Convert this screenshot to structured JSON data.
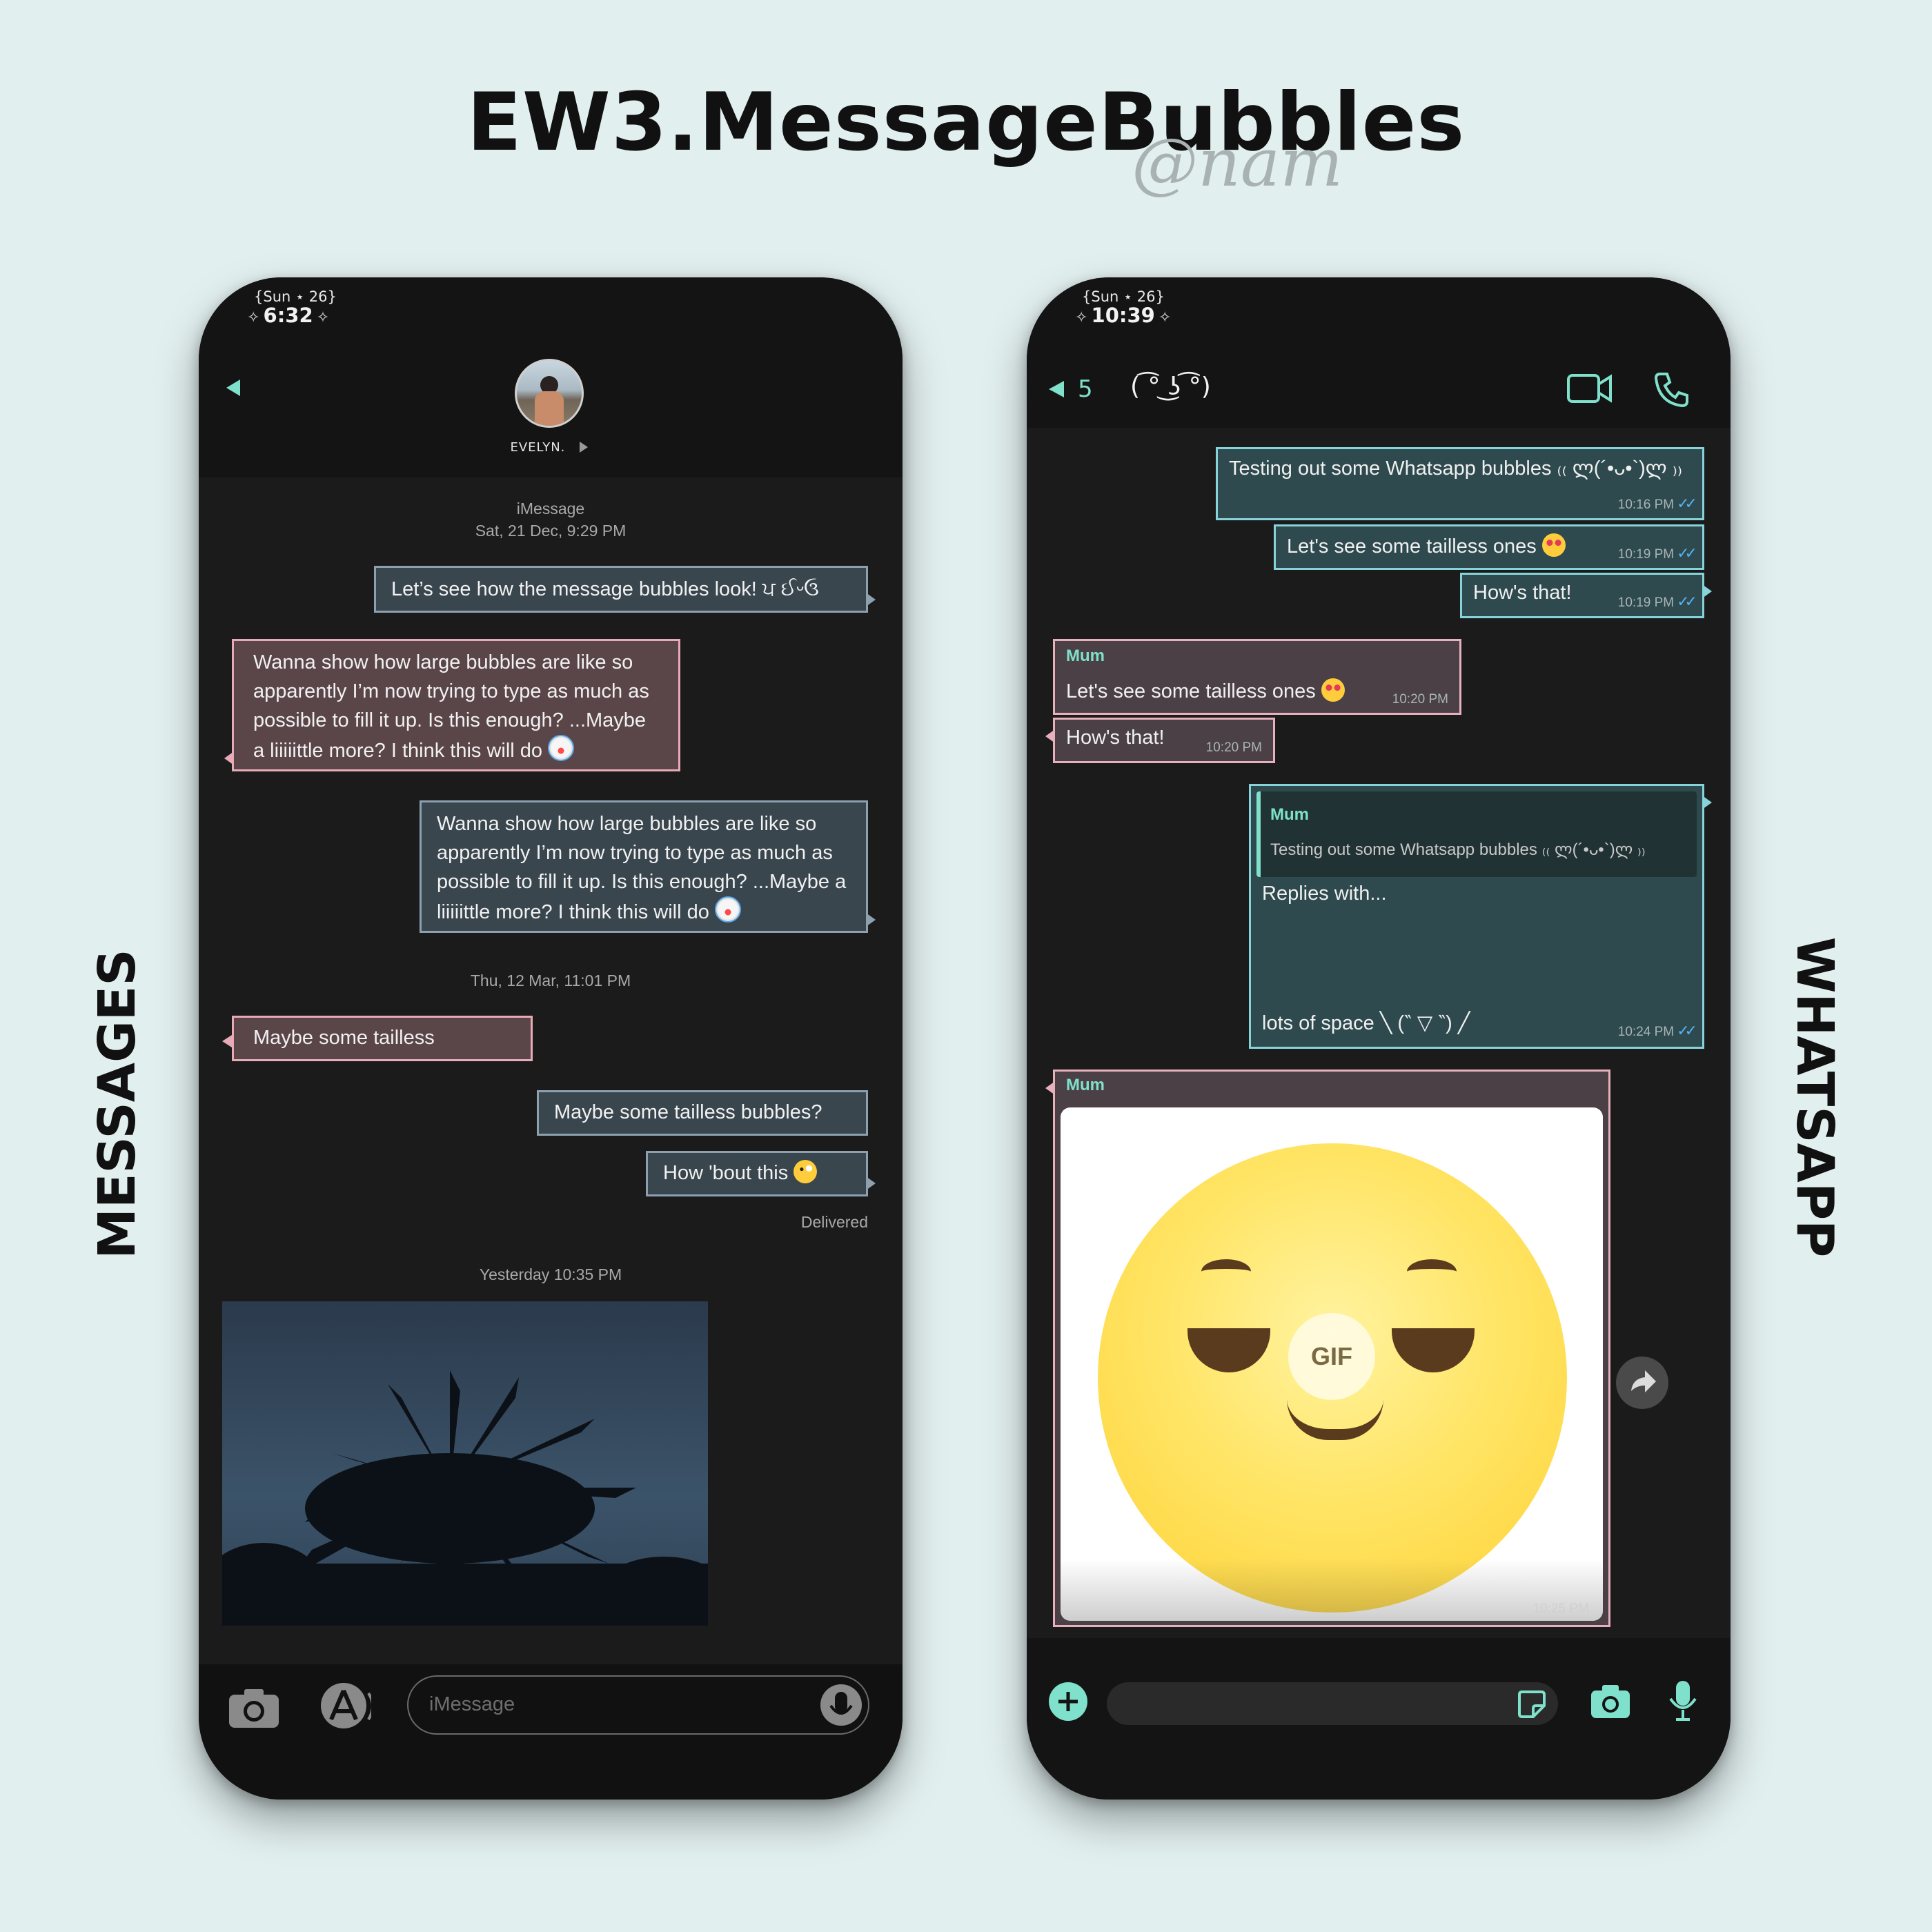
{
  "header": {
    "title": "EW3.MessageBubbles",
    "handle": "@nam"
  },
  "labels": {
    "left": "MESSAGES",
    "right": "WHATSAPP"
  },
  "messages_app": {
    "status": {
      "date": "{Sun ⋆ 26}",
      "time": "6:32"
    },
    "contact": {
      "name": "EVELYN."
    },
    "service_label": "iMessage",
    "timestamp1": "Sat, 21 Dec, 9:29 PM",
    "bubble1": "Let’s see how the message bubbles look! ਪ ઈᵕઉ",
    "bubble2": "Wanna show how large bubbles are like so apparently I’m now trying to type as much as possible to fill it up. Is this enough? ...Maybe a liiiiittle more? I think this will do",
    "bubble3": "Wanna show how large bubbles are like so apparently I’m now trying to type as much as possible to fill it up. Is this enough? ...Maybe a liiiiittle more? I think this will do",
    "timestamp2": "Thu, 12 Mar, 11:01 PM",
    "bubble4": "Maybe some tailless",
    "bubble5": "Maybe some tailless bubbles?",
    "bubble6": "How 'bout this",
    "delivered": "Delivered",
    "timestamp3": "Yesterday 10:35 PM",
    "input_placeholder": "iMessage",
    "icons": {
      "back": "back-arrow-icon",
      "camera": "camera-icon",
      "appstore": "app-store-icon",
      "audio": "audio-icon"
    },
    "colors": {
      "accent": "#7fe0cb",
      "outgoing_border": "#8da0b0",
      "incoming_border": "#e8aab7"
    }
  },
  "whatsapp_app": {
    "status": {
      "date": "{Sun ⋆ 26}",
      "time": "10:39"
    },
    "header": {
      "unread_count": "5",
      "contact": "( ͡° ͜ʖ ͡°)"
    },
    "messages": {
      "m1": {
        "text": "Testing out some Whatsapp bubbles ₍₍ ლ(´•ᴗ•`)ლ ₎₎",
        "time": "10:16 PM"
      },
      "m2": {
        "text": "Let's see some tailless ones",
        "time": "10:19 PM"
      },
      "m3": {
        "text": "How's that!",
        "time": "10:19 PM"
      },
      "m4": {
        "sender": "Mum",
        "text": "Let's see some tailless ones",
        "time": "10:20 PM"
      },
      "m5": {
        "text": "How's that!",
        "time": "10:20 PM"
      },
      "m6": {
        "quote_sender": "Mum",
        "quote_text": "Testing out some Whatsapp bubbles ₍₍ ლ(´•ᴗ•`)ლ ₎₎",
        "text_top": "Replies with...",
        "text_bottom": "lots of space ╲ (‶ ▽ ‶) ╱",
        "time": "10:24 PM"
      },
      "m7": {
        "sender": "Mum",
        "gif_label": "GIF",
        "time": "10:25 PM"
      }
    },
    "icons": {
      "back": "back-arrow-icon",
      "video": "video-call-icon",
      "phone": "phone-call-icon",
      "forward": "forward-icon",
      "add": "plus-icon",
      "sticker": "sticker-icon",
      "camera": "camera-icon",
      "mic": "microphone-icon"
    },
    "colors": {
      "accent": "#7fe0cb",
      "outgoing_border": "#86d4da",
      "incoming_border": "#e6b1bd",
      "tick": "#55b1f0"
    }
  }
}
